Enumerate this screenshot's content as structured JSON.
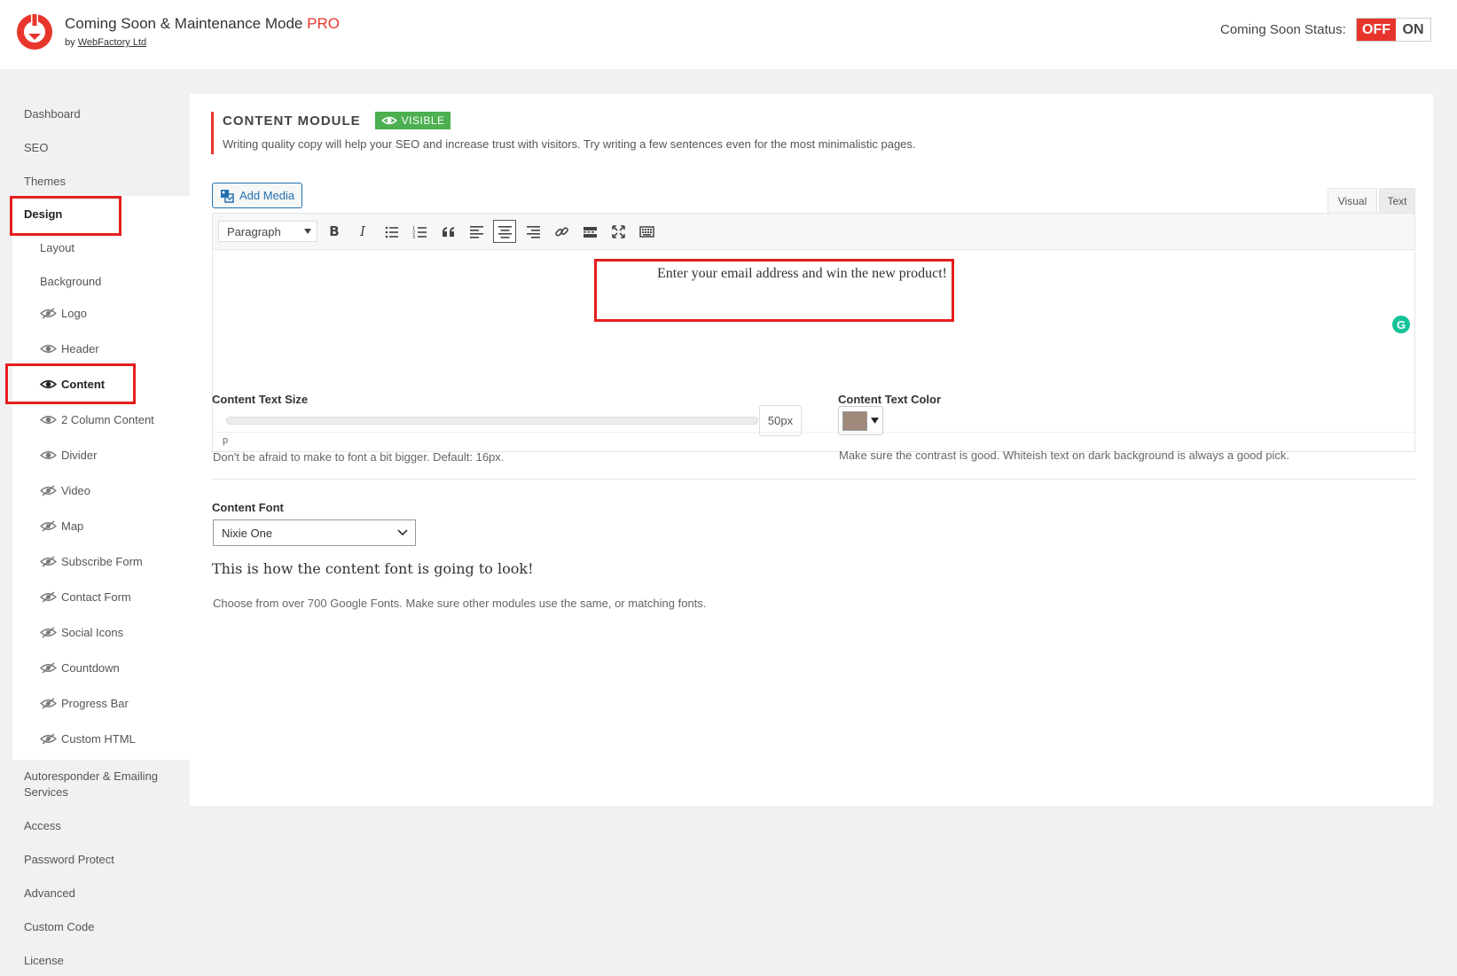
{
  "header": {
    "title": "Coming Soon & Maintenance Mode",
    "title_suffix": "PRO",
    "by": "by",
    "author": "WebFactory Ltd",
    "status_label": "Coming Soon Status:",
    "toggle_off": "OFF",
    "toggle_on": "ON"
  },
  "sidebar": {
    "items_top": [
      "Dashboard",
      "SEO",
      "Themes",
      "Design"
    ],
    "design_sub": [
      "Layout",
      "Background"
    ],
    "modules": [
      "Logo",
      "Header",
      "Content",
      "2 Column Content",
      "Divider",
      "Video",
      "Map",
      "Subscribe Form",
      "Contact Form",
      "Social Icons",
      "Countdown",
      "Progress Bar",
      "Custom HTML"
    ],
    "items_bottom": [
      "Autoresponder & Emailing Services",
      "Access",
      "Password Protect",
      "Advanced",
      "Custom Code",
      "License"
    ]
  },
  "module": {
    "title": "CONTENT MODULE",
    "badge": "VISIBLE",
    "description": "Writing quality copy will help your SEO and increase trust with visitors. Try writing a few sentences even for the most minimalistic pages."
  },
  "editor": {
    "add_media": "Add Media",
    "tab_visual": "Visual",
    "tab_text": "Text",
    "format": "Paragraph",
    "content": "Enter your email address and win the new product!",
    "path": "p"
  },
  "settings": {
    "text_size_label": "Content Text Size",
    "text_size_value": "50px",
    "text_size_help": "Don't be afraid to make to font a bit bigger. Default: 16px.",
    "color_label": "Content Text Color",
    "color_value": "#a0897b",
    "color_help": "Make sure the contrast is good. Whiteish text on dark background is always a good pick.",
    "font_label": "Content Font",
    "font_value": "Nixie One",
    "font_preview": "This is how the content font is going to look!",
    "font_help": "Choose from over 700 Google Fonts. Make sure other modules use the same, or matching fonts."
  },
  "colors": {
    "accent": "#e8352c",
    "visible": "#4caf50",
    "link": "#2271b1"
  }
}
